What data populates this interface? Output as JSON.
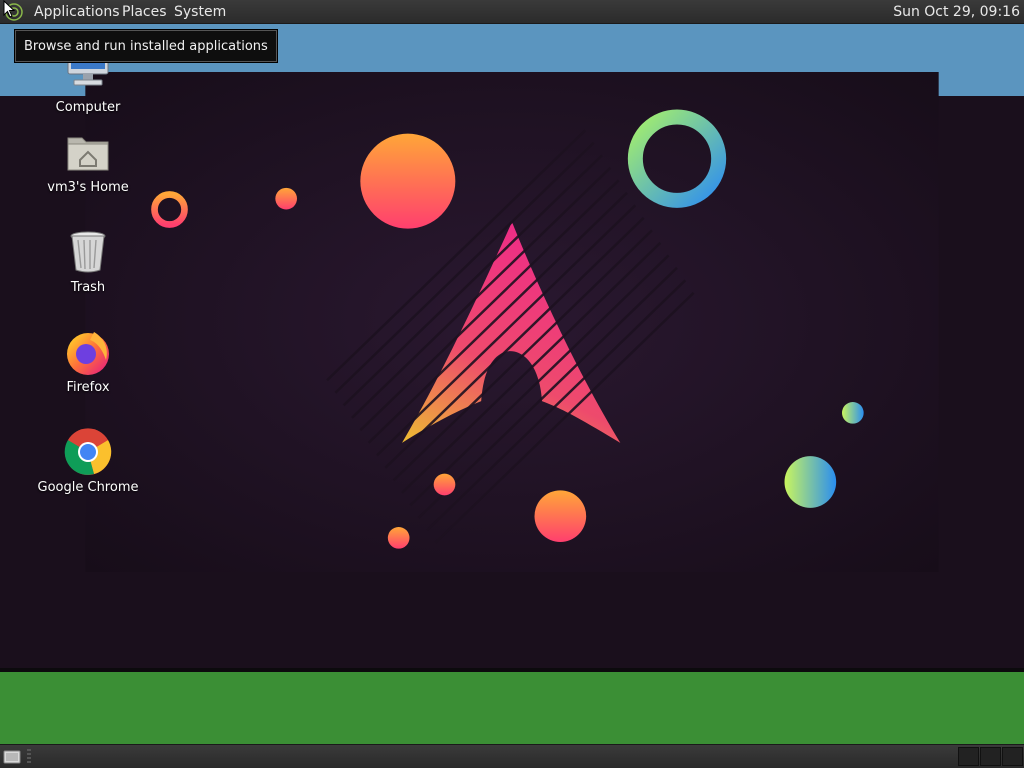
{
  "top_panel": {
    "menus": [
      "Applications",
      "Places",
      "System"
    ],
    "clock": "Sun Oct 29, 09:16"
  },
  "tooltip": {
    "text": "Browse and run installed applications"
  },
  "desktop_icons": [
    {
      "label": "Computer",
      "icon": "computer-icon"
    },
    {
      "label": "vm3's Home",
      "icon": "home-folder-icon"
    },
    {
      "label": "Trash",
      "icon": "trash-icon"
    },
    {
      "label": "Firefox",
      "icon": "firefox-icon"
    },
    {
      "label": "Google Chrome",
      "icon": "chrome-icon"
    }
  ],
  "colors": {
    "top_band": "#5b95bf",
    "bottom_band": "#3b8f35",
    "wallpaper_bg": "#1d1120",
    "panel": "#2f2f2f"
  }
}
